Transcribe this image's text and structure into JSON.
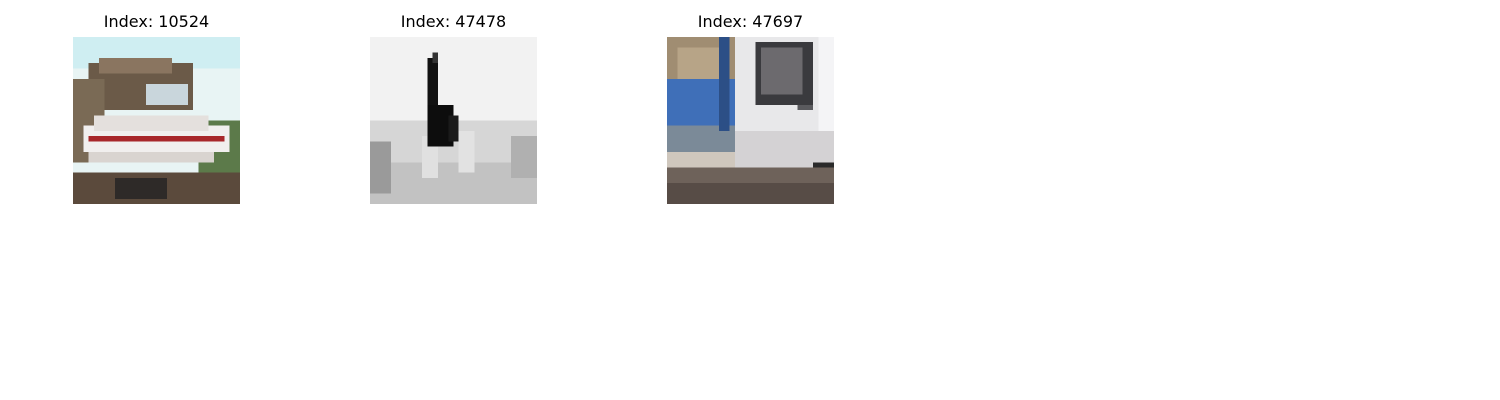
{
  "panels": [
    {
      "title": "Index: 10524",
      "subject": "boat"
    },
    {
      "title": "Index: 47478",
      "subject": "cat"
    },
    {
      "title": "Index: 47697",
      "subject": "truck"
    }
  ]
}
